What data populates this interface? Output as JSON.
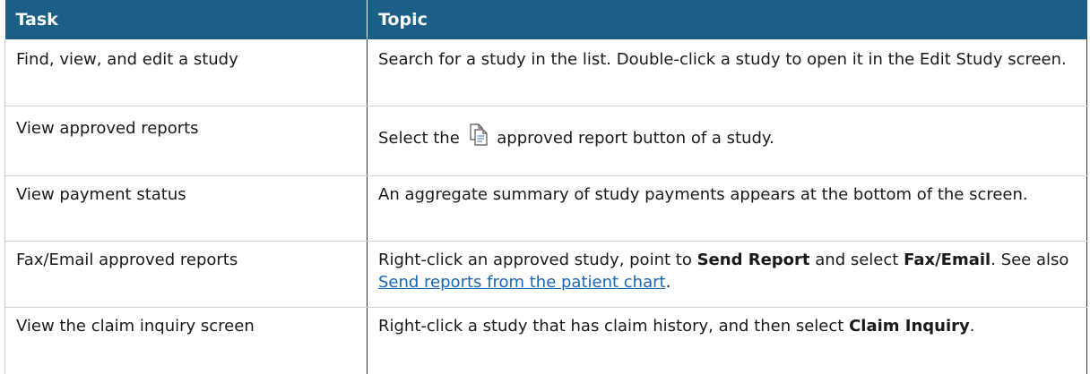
{
  "table": {
    "headers": {
      "task": "Task",
      "topic": "Topic"
    },
    "rows": [
      {
        "task": "Find, view, and edit a study",
        "topic": "Search for a study in the list. Double-click a study to open it in the Edit Study screen."
      },
      {
        "task": "View approved reports",
        "topic_before": "Select the",
        "topic_icon": "approved-report-icon",
        "topic_after": "approved report button of a study."
      },
      {
        "task": "View payment status",
        "topic": "An aggregate summary of study payments appears at the bottom of the screen."
      },
      {
        "task": "Fax/Email approved reports",
        "topic_p1": "Right-click an approved study, point to",
        "topic_b1": "Send Report",
        "topic_p2": "and select",
        "topic_b2": "Fax/Email",
        "topic_p3": ". See also",
        "topic_link": "Send reports from the patient chart",
        "topic_p4": "."
      },
      {
        "task": "View the claim inquiry screen",
        "topic_p1": "Right-click a study that has claim history, and then select",
        "topic_b1": "Claim Inquiry",
        "topic_p2": "."
      }
    ]
  },
  "colors": {
    "header_bg": "#1b5f86",
    "header_text": "#ffffff",
    "link": "#1a66b3"
  }
}
